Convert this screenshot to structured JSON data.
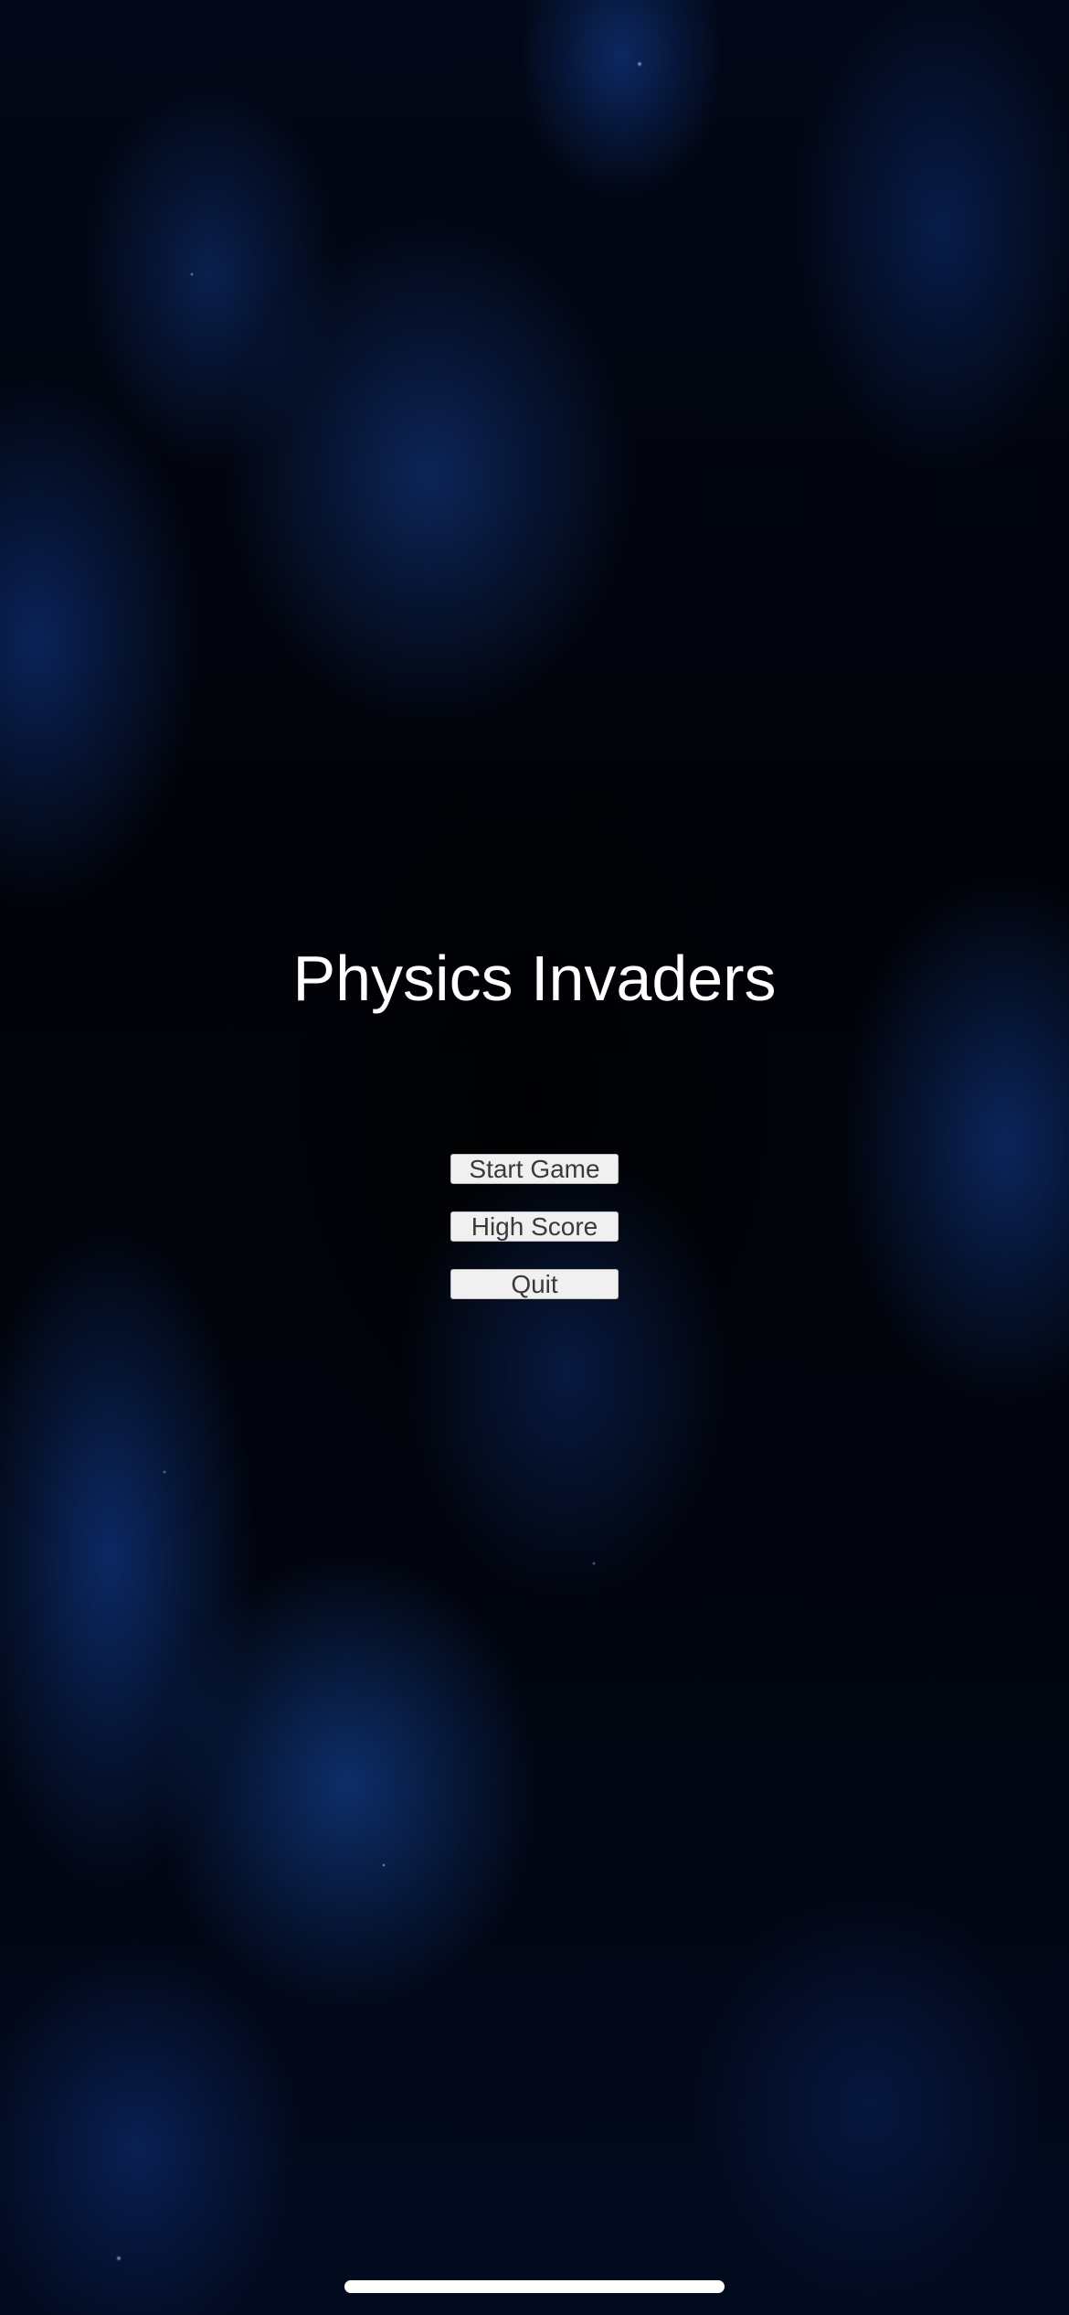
{
  "game": {
    "title": "Physics Invaders"
  },
  "menu": {
    "start_label": "Start Game",
    "high_score_label": "High Score",
    "quit_label": "Quit"
  },
  "theme": {
    "background": "#01040c",
    "nebula": "#1e5ac8",
    "title_color": "#ffffff",
    "button_bg": "#f0f0f0",
    "button_text": "#3a3a3a"
  }
}
